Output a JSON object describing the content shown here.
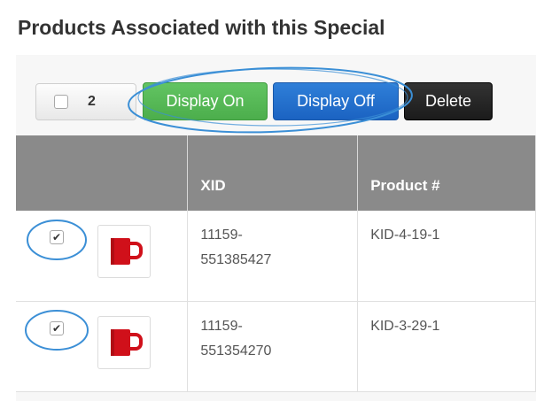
{
  "page": {
    "title": "Products Associated with this Special"
  },
  "toolbar": {
    "selected_count": "2",
    "display_on_label": "Display On",
    "display_off_label": "Display Off",
    "delete_label": "Delete"
  },
  "table": {
    "headers": [
      "",
      "XID",
      "Product #"
    ],
    "rows": [
      {
        "checked": true,
        "xid": "11159-\n551385427",
        "xid_line1": "11159-",
        "xid_line2": "551385427",
        "product": "KID-4-19-1",
        "thumb_icon": "red-mug-icon"
      },
      {
        "checked": true,
        "xid": "11159-\n551354270",
        "xid_line1": "11159-",
        "xid_line2": "551354270",
        "product": "KID-3-29-1",
        "thumb_icon": "red-mug-icon"
      }
    ]
  },
  "colors": {
    "display_on": "#5cb85c",
    "display_off": "#1f6fd0",
    "delete": "#222222",
    "header_bg": "#8a8a8a",
    "annotation": "#3b8fd6"
  }
}
